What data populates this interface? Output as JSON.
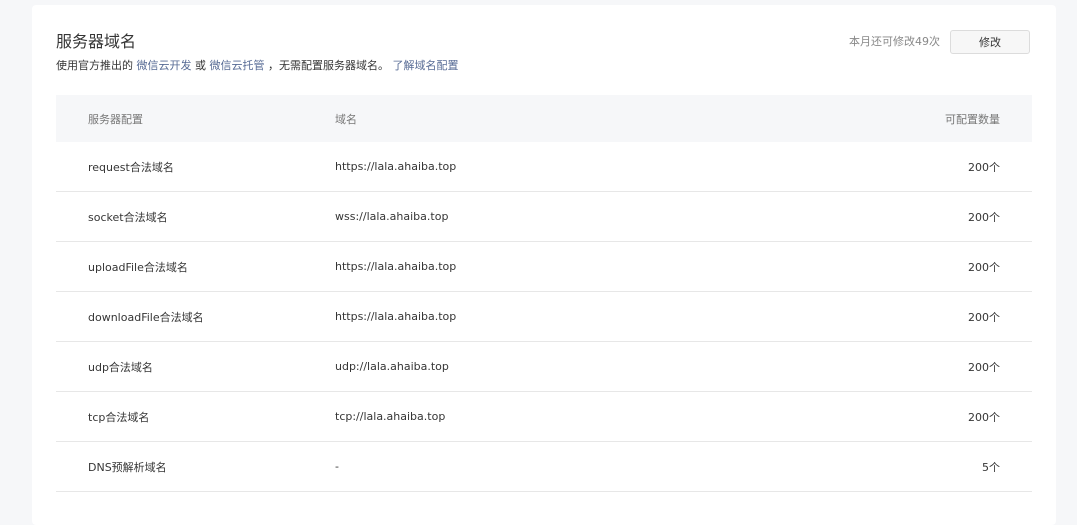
{
  "section": {
    "title": "服务器域名",
    "subtitle_prefix": "使用官方推出的",
    "link_cloud_dev": "微信云开发",
    "or_text": "或",
    "link_cloud_hosting": "微信云托管",
    "subtitle_suffix": "，无需配置服务器域名。",
    "link_learn": "了解域名配置",
    "quota_text": "本月还可修改49次",
    "modify_label": "修改"
  },
  "table": {
    "headers": {
      "config": "服务器配置",
      "domain": "域名",
      "count": "可配置数量"
    },
    "rows": [
      {
        "config": "request合法域名",
        "domain": "https://lala.ahaiba.top",
        "count": "200个"
      },
      {
        "config": "socket合法域名",
        "domain": "wss://lala.ahaiba.top",
        "count": "200个"
      },
      {
        "config": "uploadFile合法域名",
        "domain": "https://lala.ahaiba.top",
        "count": "200个"
      },
      {
        "config": "downloadFile合法域名",
        "domain": "https://lala.ahaiba.top",
        "count": "200个"
      },
      {
        "config": "udp合法域名",
        "domain": "udp://lala.ahaiba.top",
        "count": "200个"
      },
      {
        "config": "tcp合法域名",
        "domain": "tcp://lala.ahaiba.top",
        "count": "200个"
      },
      {
        "config": "DNS预解析域名",
        "domain": "-",
        "count": "5个"
      }
    ]
  },
  "colors": {
    "link": "#576b95",
    "text": "#353535",
    "muted": "#888888",
    "header_bg": "#f6f7f9"
  }
}
